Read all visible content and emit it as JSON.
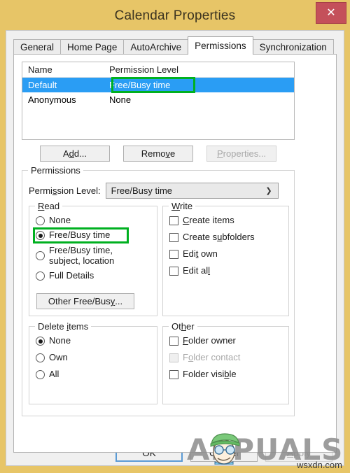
{
  "window": {
    "title": "Calendar Properties",
    "close_icon": "close-icon",
    "titlebar_color": "#e7c567",
    "close_button_color": "#c4505a"
  },
  "tabs": [
    {
      "label": "General",
      "active": false
    },
    {
      "label": "Home Page",
      "active": false
    },
    {
      "label": "AutoArchive",
      "active": false
    },
    {
      "label": "Permissions",
      "active": true
    },
    {
      "label": "Synchronization",
      "active": false
    }
  ],
  "permission_list": {
    "columns": [
      "Name",
      "Permission Level"
    ],
    "rows": [
      {
        "name": "Default",
        "level": "Free/Busy time",
        "selected": true
      },
      {
        "name": "Anonymous",
        "level": "None",
        "selected": false
      }
    ],
    "selection_color": "#2a9df4"
  },
  "list_buttons": [
    {
      "label_pre": "A",
      "label_accel": "d",
      "label_post": "d...",
      "disabled": false,
      "name": "add-button"
    },
    {
      "label_pre": "Remo",
      "label_accel": "v",
      "label_post": "e",
      "disabled": false,
      "name": "remove-button"
    },
    {
      "label_pre": "",
      "label_accel": "P",
      "label_post": "roperties...",
      "disabled": true,
      "name": "properties-button"
    }
  ],
  "permissions_group": {
    "legend": "Permissions",
    "permission_level": {
      "label_pre": "Permi",
      "label_accel": "s",
      "label_post": "sion Level:",
      "value": "Free/Busy time",
      "arrow_icon": "chevron-down-icon"
    },
    "read": {
      "legend_pre": "",
      "legend_accel": "R",
      "legend_post": "ead",
      "options": [
        {
          "label": "None",
          "checked": false
        },
        {
          "label": "Free/Busy time",
          "checked": true,
          "highlighted": true
        },
        {
          "label": "Free/Busy time, subject, location",
          "checked": false
        },
        {
          "label": "Full Details",
          "checked": false
        }
      ],
      "other_button": {
        "pre": "Other Free/Bus",
        "accel": "y",
        "post": "..."
      }
    },
    "write": {
      "legend_pre": "",
      "legend_accel": "W",
      "legend_post": "rite",
      "options": [
        {
          "pre": "",
          "accel": "C",
          "post": "reate items",
          "checked": false,
          "disabled": false
        },
        {
          "pre": "Create s",
          "accel": "u",
          "post": "bfolders",
          "checked": false,
          "disabled": false
        },
        {
          "pre": "Edi",
          "accel": "t",
          "post": " own",
          "checked": false,
          "disabled": false
        },
        {
          "pre": "Edit al",
          "accel": "l",
          "post": "",
          "checked": false,
          "disabled": false
        }
      ]
    },
    "delete_items": {
      "legend_pre": "Delete ",
      "legend_accel": "i",
      "legend_post": "tems",
      "options": [
        {
          "label": "None",
          "checked": true
        },
        {
          "label": "Own",
          "checked": false
        },
        {
          "label": "All",
          "checked": false
        }
      ]
    },
    "other": {
      "legend_pre": "Ot",
      "legend_accel": "h",
      "legend_post": "er",
      "options": [
        {
          "pre": "",
          "accel": "F",
          "post": "older owner",
          "checked": false,
          "disabled": false
        },
        {
          "pre": "F",
          "accel": "o",
          "post": "lder contact",
          "checked": false,
          "disabled": true
        },
        {
          "pre": "Folder visi",
          "accel": "b",
          "post": "le",
          "checked": false,
          "disabled": false
        }
      ]
    }
  },
  "dialog_buttons": [
    {
      "pre": "OK",
      "accel": "",
      "post": "",
      "disabled": false,
      "default": true,
      "name": "ok-button"
    },
    {
      "pre": "Cancel",
      "accel": "",
      "post": "",
      "disabled": false,
      "default": false,
      "name": "cancel-button"
    },
    {
      "pre": "",
      "accel": "A",
      "post": "pply",
      "disabled": true,
      "default": false,
      "name": "apply-button"
    }
  ],
  "annotations": {
    "highlight_color": "#00b020",
    "boxes": [
      "list-permission-level-cell",
      "read-free-busy-time-radio"
    ]
  },
  "watermarks": {
    "brand": "APPUALS",
    "site": "wsxdn.com"
  }
}
